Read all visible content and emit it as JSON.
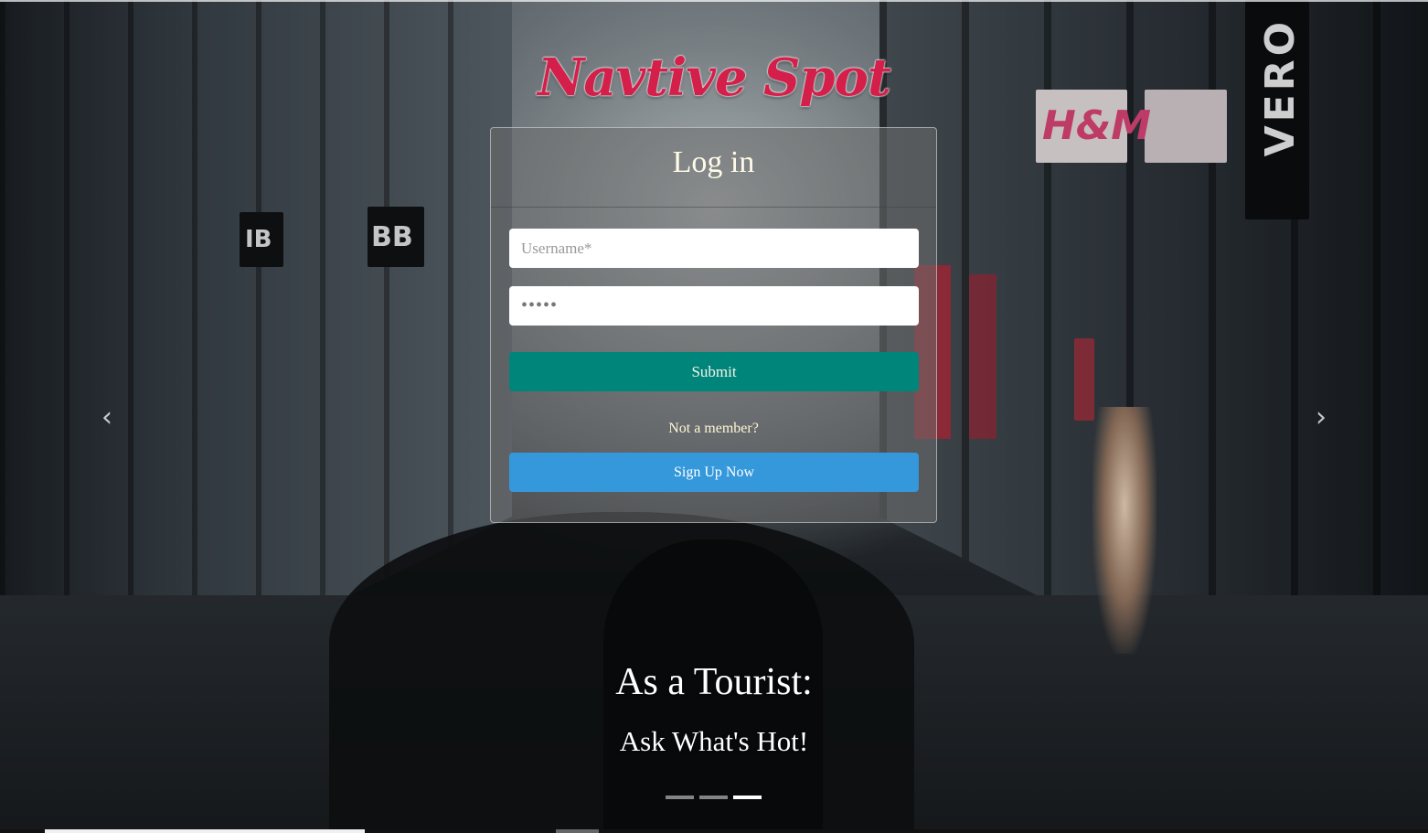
{
  "brand": {
    "name": "Navtive Spot"
  },
  "login": {
    "title": "Log in",
    "username_placeholder": "Username*",
    "password_value": "•••••",
    "submit_label": "Submit",
    "not_member_text": "Not a member?",
    "signup_label": "Sign Up Now"
  },
  "carousel": {
    "caption_title": "As a Tourist:",
    "caption_subtitle": "Ask What's Hot!",
    "prev_icon": "chevron-left-icon",
    "next_icon": "chevron-right-icon",
    "prev_glyph": "‹",
    "next_glyph": "›",
    "slide_count": 3,
    "active_index": 2
  },
  "background_signs": {
    "hm": "H&M",
    "vero": "VERO",
    "bb": "BB",
    "ib": "IB"
  },
  "colors": {
    "brand": "#d41f4a",
    "submit": "#00857a",
    "signup": "#3498db"
  }
}
